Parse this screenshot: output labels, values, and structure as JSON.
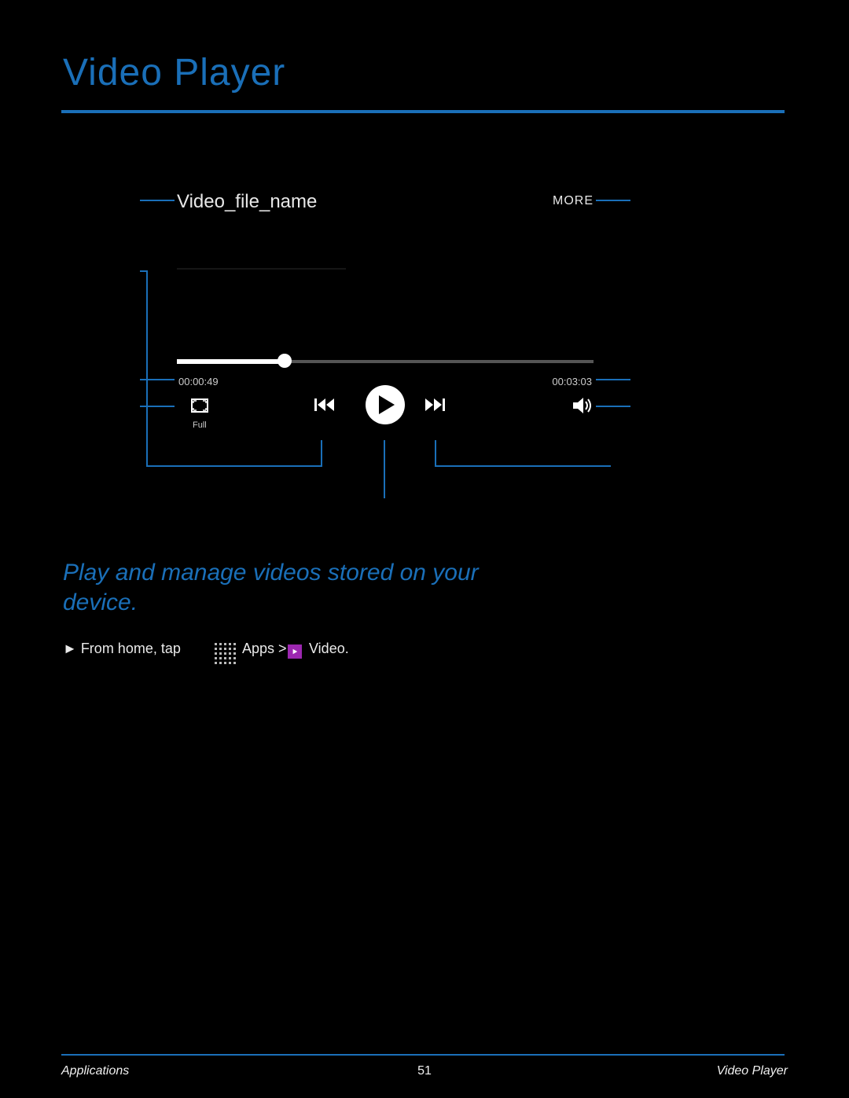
{
  "title": "Video Player",
  "player": {
    "file_name": "Video_file_name",
    "more_label": "MORE",
    "time_elapsed": "00:00:49",
    "time_total": "00:03:03",
    "full_label": "Full"
  },
  "tagline": "Play and manage videos stored on your device.",
  "instruction": {
    "prefix": "► From home, tap ",
    "apps_label": "Apps > ",
    "video_label": "Video."
  },
  "footer": {
    "left": "Applications",
    "center": "51",
    "right": "Video Player"
  }
}
